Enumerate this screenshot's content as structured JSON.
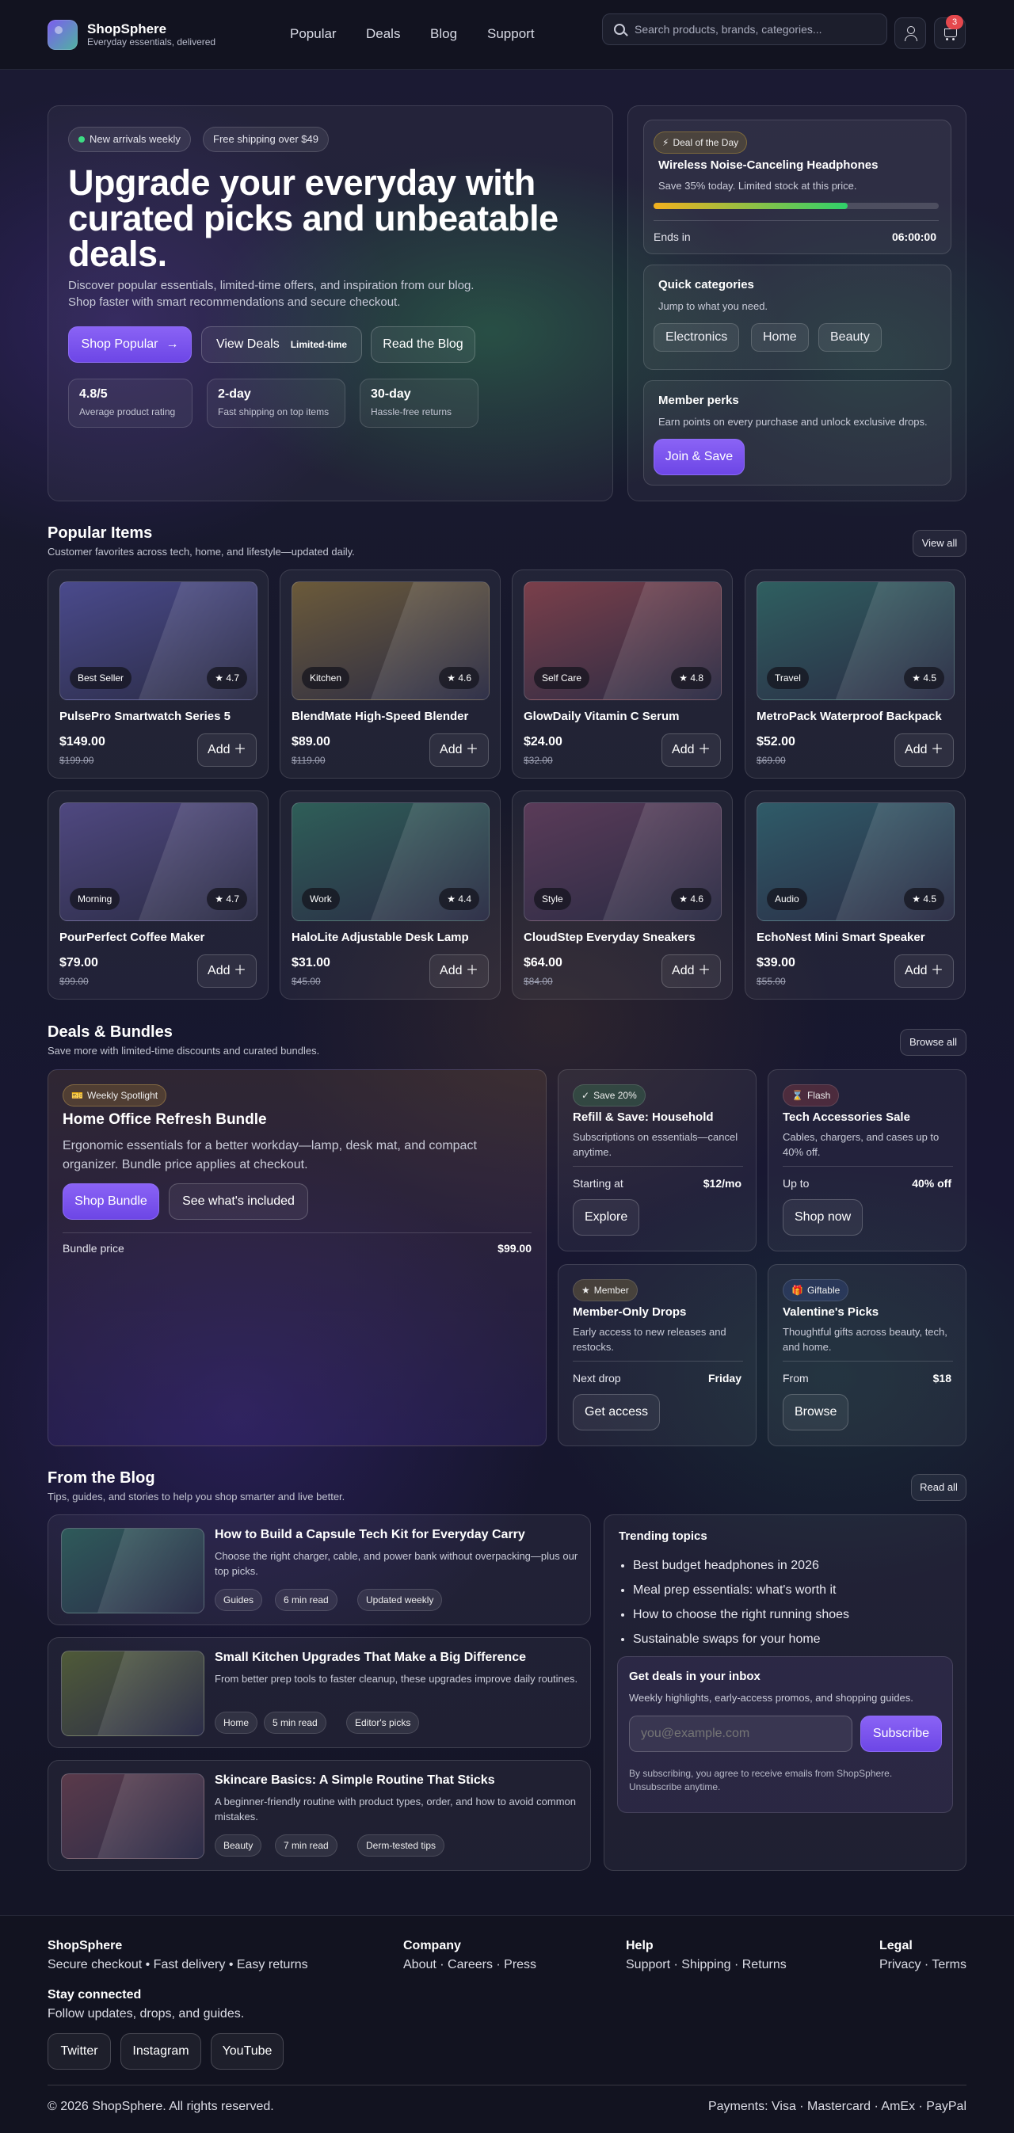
{
  "header": {
    "brand": "ShopSphere",
    "tagline": "Everyday essentials, delivered",
    "nav": [
      "Popular",
      "Deals",
      "Blog",
      "Support"
    ],
    "search_placeholder": "Search products, brands, categories...",
    "cart_count": "3"
  },
  "hero": {
    "pill_new": "New arrivals weekly",
    "pill_shipping": "Free shipping over $49",
    "title": "Upgrade your everyday with curated picks and unbeatable deals.",
    "subtitle": "Discover popular essentials, limited-time offers, and inspiration from our blog. Shop faster with smart recommendations and secure checkout.",
    "btn_popular": "Shop Popular",
    "btn_deals": "View Deals",
    "btn_deals_tag": "Limited-time",
    "btn_blog": "Read the Blog",
    "stats": [
      {
        "value": "4.8/5",
        "label": "Average product rating"
      },
      {
        "value": "2-day",
        "label": "Fast shipping on top items"
      },
      {
        "value": "30-day",
        "label": "Hassle-free returns"
      }
    ]
  },
  "deal_of_day": {
    "badge": "Deal of the Day",
    "title": "Wireless Noise-Canceling Headphones",
    "desc": "Save 35% today. Limited stock at this price.",
    "progress": 0.68,
    "ends_label": "Ends in",
    "ends_value": "06:00:00"
  },
  "quick_categories": {
    "title": "Quick categories",
    "desc": "Jump to what you need.",
    "items": [
      "Electronics",
      "Home",
      "Beauty"
    ]
  },
  "member_perks": {
    "title": "Member perks",
    "desc": "Earn points on every purchase and unlock exclusive drops.",
    "button": "Join & Save"
  },
  "popular": {
    "title": "Popular Items",
    "subtitle": "Customer favorites across tech, home, and lifestyle—updated daily.",
    "view_all": "View all",
    "add_label": "Add",
    "products": [
      {
        "name": "PulsePro Smartwatch Series 5",
        "category": "Best Seller",
        "rating": "4.7",
        "price": "$149.00",
        "old": "$199.00",
        "color": "#4a4a8c"
      },
      {
        "name": "BlendMate High-Speed Blender",
        "category": "Kitchen",
        "rating": "4.6",
        "price": "$89.00",
        "old": "$119.00",
        "color": "#6b5a3a"
      },
      {
        "name": "GlowDaily Vitamin C Serum",
        "category": "Self Care",
        "rating": "4.8",
        "price": "$24.00",
        "old": "$32.00",
        "color": "#7a3f4a"
      },
      {
        "name": "MetroPack Waterproof Backpack",
        "category": "Travel",
        "rating": "4.5",
        "price": "$52.00",
        "old": "$69.00",
        "color": "#2f5f60"
      },
      {
        "name": "PourPerfect Coffee Maker",
        "category": "Morning",
        "rating": "4.7",
        "price": "$79.00",
        "old": "$99.00",
        "color": "#4f4880"
      },
      {
        "name": "HaloLite Adjustable Desk Lamp",
        "category": "Work",
        "rating": "4.4",
        "price": "$31.00",
        "old": "$45.00",
        "color": "#2e5e58"
      },
      {
        "name": "CloudStep Everyday Sneakers",
        "category": "Style",
        "rating": "4.6",
        "price": "$64.00",
        "old": "$84.00",
        "color": "#5a3b58"
      },
      {
        "name": "EchoNest Mini Smart Speaker",
        "category": "Audio",
        "rating": "4.5",
        "price": "$39.00",
        "old": "$55.00",
        "color": "#2f5b68"
      }
    ]
  },
  "deals": {
    "title": "Deals & Bundles",
    "subtitle": "Save more with limited-time discounts and curated bundles.",
    "browse_all": "Browse all",
    "spotlight": {
      "badge": "Weekly Spotlight",
      "title": "Home Office Refresh Bundle",
      "desc": "Ergonomic essentials for a better workday—lamp, desk mat, and compact organizer. Bundle price applies at checkout.",
      "btn_shop": "Shop Bundle",
      "btn_see": "See what's included",
      "price_label": "Bundle price",
      "price": "$99.00"
    },
    "cards": [
      {
        "badge": "Save 20%",
        "icon": "check",
        "title": "Refill & Save: Household",
        "desc": "Subscriptions on essentials—cancel anytime.",
        "label": "Starting at",
        "value": "$12/mo",
        "button": "Explore"
      },
      {
        "badge": "Flash",
        "icon": "hourglass",
        "title": "Tech Accessories Sale",
        "desc": "Cables, chargers, and cases up to 40% off.",
        "label": "Up to",
        "value": "40% off",
        "button": "Shop now"
      },
      {
        "badge": "Member",
        "icon": "star",
        "title": "Member-Only Drops",
        "desc": "Early access to new releases and restocks.",
        "label": "Next drop",
        "value": "Friday",
        "button": "Get access"
      },
      {
        "badge": "Giftable",
        "icon": "gift",
        "title": "Valentine's Picks",
        "desc": "Thoughtful gifts across beauty, tech, and home.",
        "label": "From",
        "value": "$18",
        "button": "Browse"
      }
    ]
  },
  "blog": {
    "title": "From the Blog",
    "subtitle": "Tips, guides, and stories to help you shop smarter and live better.",
    "read_all": "Read all",
    "posts": [
      {
        "title": "How to Build a Capsule Tech Kit for Everyday Carry",
        "desc": "Choose the right charger, cable, and power bank without overpacking—plus our top picks.",
        "tags": [
          "Guides",
          "6 min read",
          "Updated weekly"
        ],
        "color": "#2e5a5a"
      },
      {
        "title": "Small Kitchen Upgrades That Make a Big Difference",
        "desc": "From better prep tools to faster cleanup, these upgrades improve daily routines.",
        "tags": [
          "Home",
          "5 min read",
          "Editor's picks"
        ],
        "color": "#4f5a38"
      },
      {
        "title": "Skincare Basics: A Simple Routine That Sticks",
        "desc": "A beginner-friendly routine with product types, order, and how to avoid common mistakes.",
        "tags": [
          "Beauty",
          "7 min read",
          "Derm-tested tips"
        ],
        "color": "#5a3a4a"
      }
    ],
    "trending_title": "Trending topics",
    "trending": [
      "Best budget headphones in 2026",
      "Meal prep essentials: what's worth it",
      "How to choose the right running shoes",
      "Sustainable swaps for your home"
    ],
    "newsletter": {
      "title": "Get deals in your inbox",
      "desc": "Weekly highlights, early-access promos, and shopping guides.",
      "placeholder": "you@example.com",
      "button": "Subscribe",
      "note": "By subscribing, you agree to receive emails from ShopSphere. Unsubscribe anytime."
    }
  },
  "footer": {
    "brand": "ShopSphere",
    "brand_line": "Secure checkout • Fast delivery • Easy returns",
    "company": "Company",
    "company_links": "About · Careers · Press",
    "help": "Help",
    "help_links": "Support · Shipping · Returns",
    "legal": "Legal",
    "legal_links": "Privacy · Terms",
    "stay": "Stay connected",
    "stay_desc": "Follow updates, drops, and guides.",
    "social": [
      "Twitter",
      "Instagram",
      "YouTube"
    ],
    "copyright": "© 2026 ShopSphere. All rights reserved.",
    "payments": "Payments: Visa · Mastercard · AmEx · PayPal"
  },
  "colors": {
    "accent": "#7c5cf0",
    "progress_start": "#f2b01e",
    "progress_end": "#2fd06a",
    "badge": "#e5484d"
  }
}
